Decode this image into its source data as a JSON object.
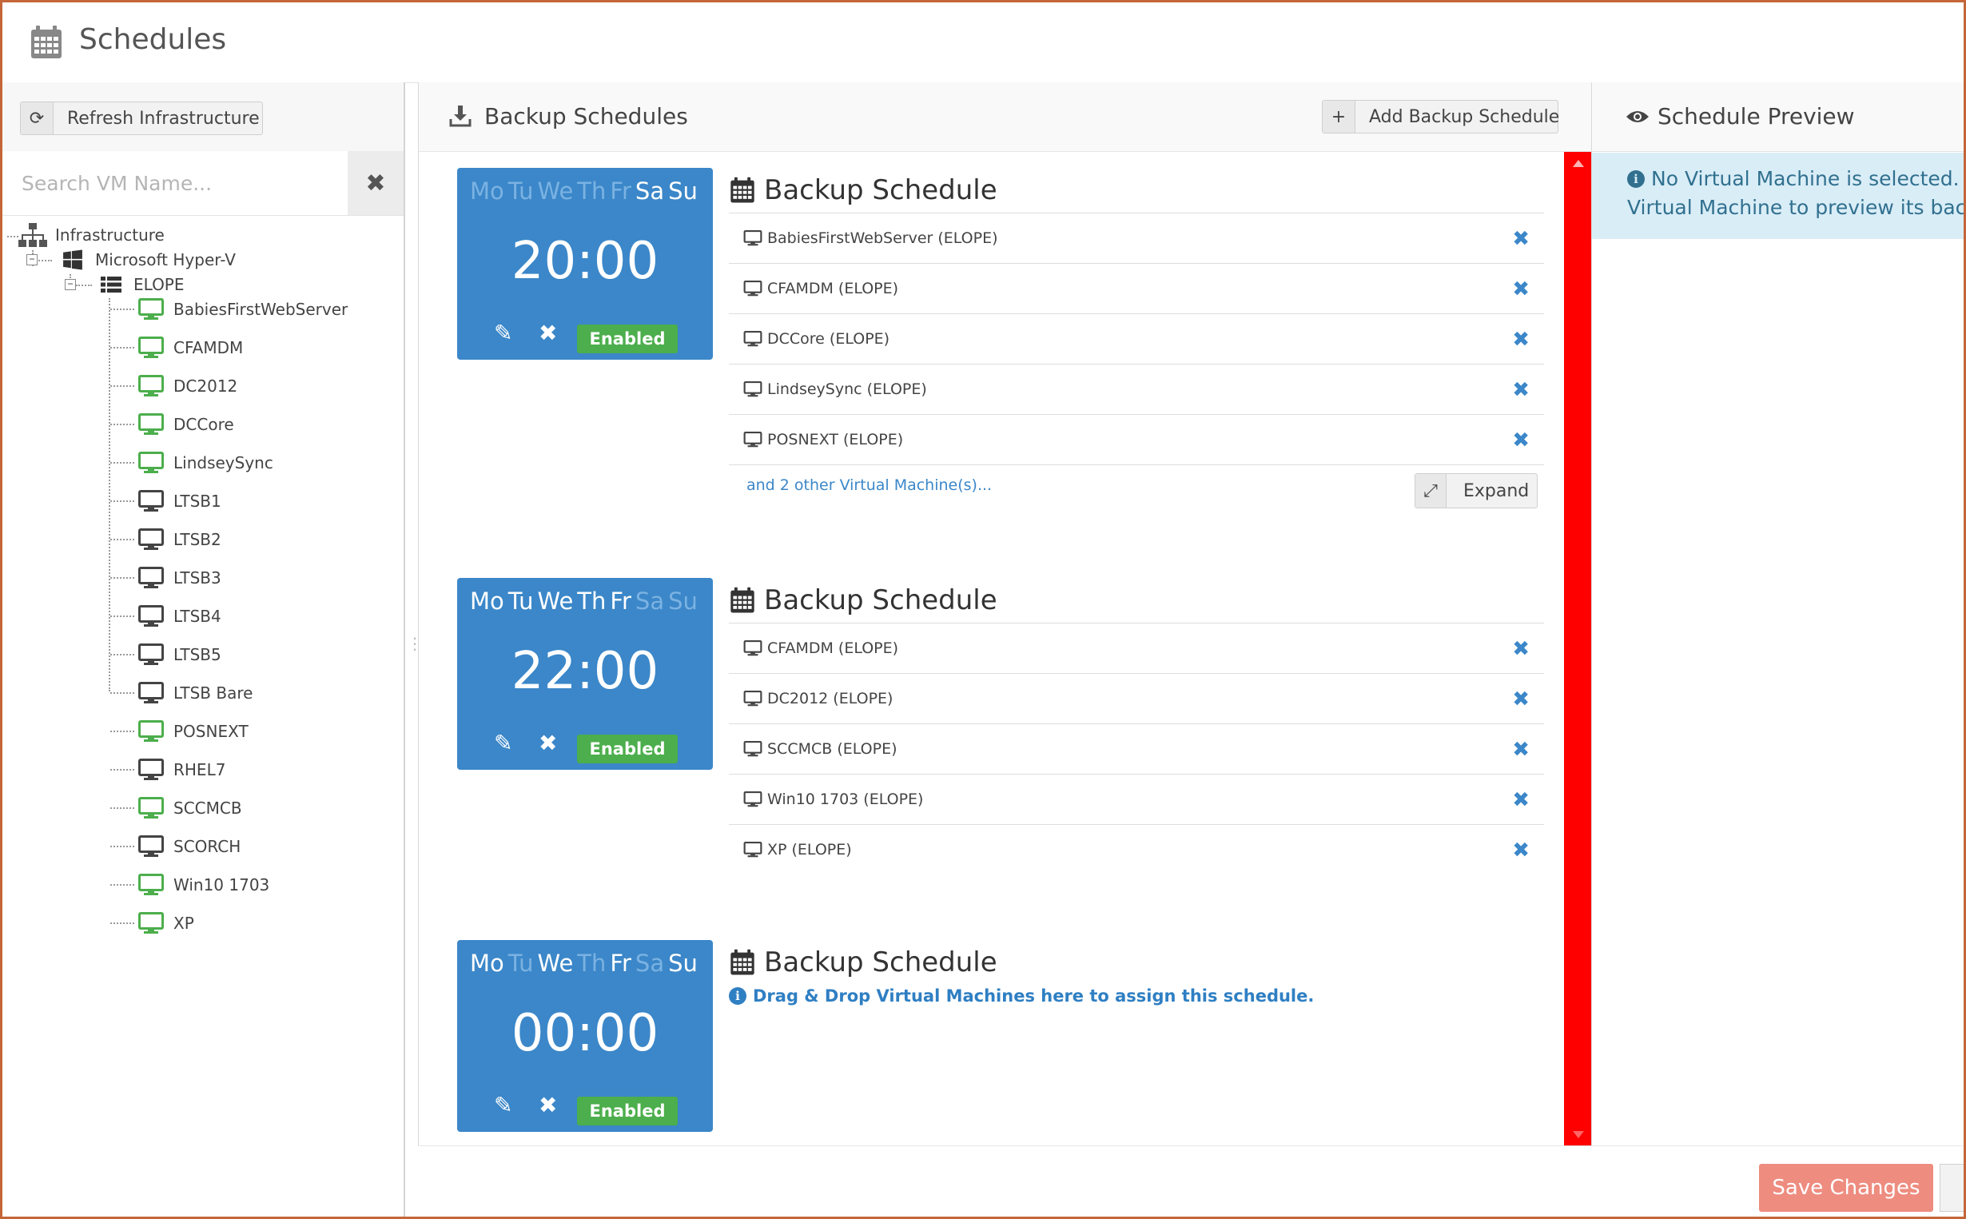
{
  "window": {
    "title": "Schedules"
  },
  "left": {
    "refresh_label": "Refresh Infrastructure",
    "search_placeholder": "Search VM Name...",
    "tree": {
      "root": "Infrastructure",
      "hypervisor": "Microsoft Hyper-V",
      "host": "ELOPE",
      "vms": [
        {
          "name": "BabiesFirstWebServer",
          "status": "green"
        },
        {
          "name": "CFAMDM",
          "status": "green"
        },
        {
          "name": "DC2012",
          "status": "green"
        },
        {
          "name": "DCCore",
          "status": "green"
        },
        {
          "name": "LindseySync",
          "status": "green"
        },
        {
          "name": "LTSB1",
          "status": "gray"
        },
        {
          "name": "LTSB2",
          "status": "gray"
        },
        {
          "name": "LTSB3",
          "status": "gray"
        },
        {
          "name": "LTSB4",
          "status": "gray"
        },
        {
          "name": "LTSB5",
          "status": "gray"
        },
        {
          "name": "LTSB Bare",
          "status": "gray"
        },
        {
          "name": "POSNEXT",
          "status": "green"
        },
        {
          "name": "RHEL7",
          "status": "gray"
        },
        {
          "name": "SCCMCB",
          "status": "green"
        },
        {
          "name": "SCORCH",
          "status": "gray"
        },
        {
          "name": "Win10 1703",
          "status": "green"
        },
        {
          "name": "XP",
          "status": "green"
        }
      ]
    }
  },
  "middle": {
    "title": "Backup Schedules",
    "add_label": "Add Backup Schedule",
    "schedules": [
      {
        "heading": "Backup Schedule",
        "days": [
          {
            "d": "Mo",
            "on": false
          },
          {
            "d": "Tu",
            "on": false
          },
          {
            "d": "We",
            "on": false
          },
          {
            "d": "Th",
            "on": false
          },
          {
            "d": "Fr",
            "on": false
          },
          {
            "d": "Sa",
            "on": true
          },
          {
            "d": "Su",
            "on": true
          }
        ],
        "time": "20:00",
        "status": "Enabled",
        "vms": [
          "BabiesFirstWebServer (ELOPE)",
          "CFAMDM (ELOPE)",
          "DCCore (ELOPE)",
          "LindseySync (ELOPE)",
          "POSNEXT (ELOPE)"
        ],
        "more": "and 2 other Virtual Machine(s)...",
        "expand_label": "Expand"
      },
      {
        "heading": "Backup Schedule",
        "days": [
          {
            "d": "Mo",
            "on": true
          },
          {
            "d": "Tu",
            "on": true
          },
          {
            "d": "We",
            "on": true
          },
          {
            "d": "Th",
            "on": true
          },
          {
            "d": "Fr",
            "on": true
          },
          {
            "d": "Sa",
            "on": false
          },
          {
            "d": "Su",
            "on": false
          }
        ],
        "time": "22:00",
        "status": "Enabled",
        "vms": [
          "CFAMDM (ELOPE)",
          "DC2012 (ELOPE)",
          "SCCMCB (ELOPE)",
          "Win10 1703 (ELOPE)",
          "XP (ELOPE)"
        ]
      },
      {
        "heading": "Backup Schedule",
        "days": [
          {
            "d": "Mo",
            "on": true
          },
          {
            "d": "Tu",
            "on": false
          },
          {
            "d": "We",
            "on": true
          },
          {
            "d": "Th",
            "on": false
          },
          {
            "d": "Fr",
            "on": true
          },
          {
            "d": "Sa",
            "on": false
          },
          {
            "d": "Su",
            "on": true
          }
        ],
        "time": "00:00",
        "status": "Enabled",
        "drop_hint": "Drag & Drop Virtual Machines here to assign this schedule."
      }
    ]
  },
  "right": {
    "title": "Schedule Preview",
    "info_line1": "No Virtual Machine is selected. P",
    "info_line2": "Virtual Machine to preview its back"
  },
  "footer": {
    "save_label": "Save Changes"
  },
  "colors": {
    "tile_blue": "#3b87c9",
    "enabled_green": "#4cae4c",
    "vm_green": "#4cae4c",
    "scrollbar_red": "#ff0000",
    "save_red": "#ee8c80",
    "info_bg": "#d9edf7"
  },
  "icons": {
    "title": "calendar-icon",
    "refresh": "refresh-icon",
    "clear": "close-icon",
    "backup": "download-icon",
    "add": "plus-icon",
    "preview": "eye-icon",
    "vm": "monitor-icon",
    "remove": "remove-x-icon",
    "edit": "pencil-icon",
    "expand": "expand-icon"
  }
}
